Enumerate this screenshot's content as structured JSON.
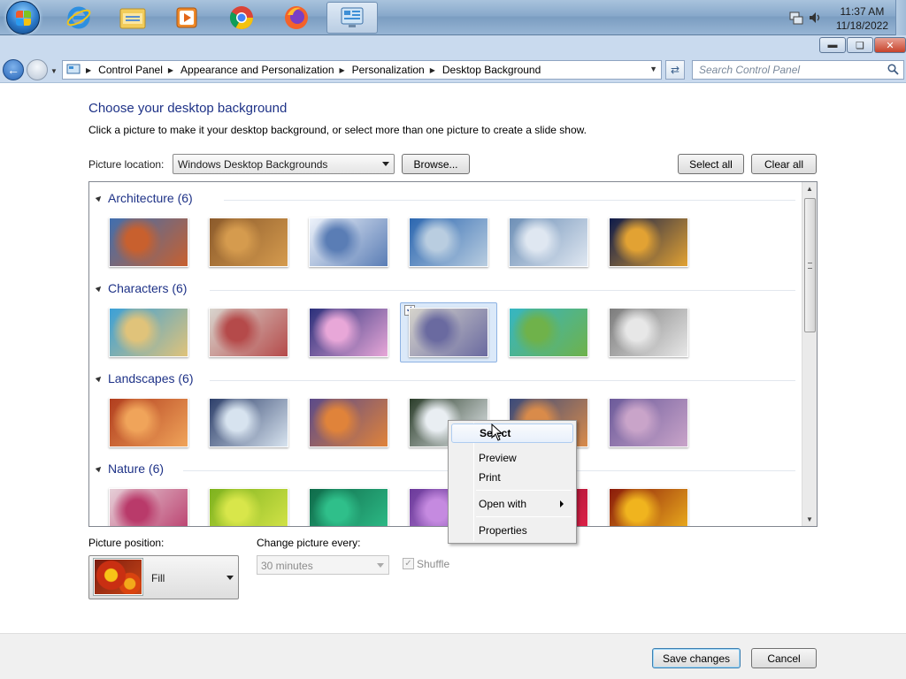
{
  "taskbar": {
    "apps": [
      {
        "name": "internet-explorer-icon"
      },
      {
        "name": "windows-explorer-icon"
      },
      {
        "name": "media-player-icon"
      },
      {
        "name": "chrome-icon"
      },
      {
        "name": "firefox-icon"
      },
      {
        "name": "control-panel-icon",
        "active": true
      }
    ],
    "tray": {
      "time": "11:37 AM",
      "date": "11/18/2022"
    }
  },
  "navbar": {
    "breadcrumbs": [
      "Control Panel",
      "Appearance and Personalization",
      "Personalization",
      "Desktop Background"
    ],
    "search_placeholder": "Search Control Panel"
  },
  "page": {
    "title": "Choose your desktop background",
    "description": "Click a picture to make it your desktop background, or select more than one picture to create a slide show.",
    "location_label": "Picture location:",
    "location_value": "Windows Desktop Backgrounds",
    "browse_label": "Browse...",
    "select_all_label": "Select all",
    "clear_all_label": "Clear all"
  },
  "gallery": {
    "groups": [
      {
        "name": "Architecture (6)",
        "thumbs": [
          [
            "#3f6fb0",
            "#c8602e"
          ],
          [
            "#8b5a2b",
            "#d59b4e"
          ],
          [
            "#eef3fb",
            "#5a7db5"
          ],
          [
            "#2b66b0",
            "#b9cde0"
          ],
          [
            "#6d8fb6",
            "#dfe7f1"
          ],
          [
            "#0d1a4a",
            "#e2a233"
          ]
        ]
      },
      {
        "name": "Characters (6)",
        "thumbs": [
          [
            "#3aa0d8",
            "#e0c37a"
          ],
          [
            "#d9d6cf",
            "#b54a4a"
          ],
          [
            "#2a2f7a",
            "#e8a7d8"
          ],
          [
            "#d6d4cc",
            "#6a6aa0"
          ],
          [
            "#35b6c4",
            "#6fb24a"
          ],
          [
            "#7b7b7b",
            "#e7e7e7"
          ]
        ],
        "selected_index": 3
      },
      {
        "name": "Landscapes (6)",
        "thumbs": [
          [
            "#b13d1e",
            "#f0a45a"
          ],
          [
            "#2d3f6a",
            "#d7e3ef"
          ],
          [
            "#5a4a8a",
            "#e0833a"
          ],
          [
            "#2b3d2a",
            "#e9eef2"
          ],
          [
            "#3a4a7a",
            "#d98b4a"
          ],
          [
            "#6b5a9a",
            "#c9a4c9"
          ]
        ]
      },
      {
        "name": "Nature (6)",
        "thumbs": [
          [
            "#e6d0d8",
            "#b93a6a"
          ],
          [
            "#7db21e",
            "#d8e64a"
          ],
          [
            "#0f6b4a",
            "#2fbf8a"
          ],
          [
            "#6b3a9a",
            "#c58ae0"
          ],
          [
            "#8a0f2a",
            "#e3224a"
          ],
          [
            "#8a1a0a",
            "#f0b41e"
          ]
        ]
      }
    ]
  },
  "context_menu": {
    "items": [
      "Select",
      "Preview",
      "Print",
      "Open with",
      "Properties"
    ]
  },
  "settings": {
    "position_label": "Picture position:",
    "position_value": "Fill",
    "change_label": "Change picture every:",
    "change_value": "30 minutes",
    "shuffle_label": "Shuffle",
    "shuffle_checked": true
  },
  "footer": {
    "save_label": "Save changes",
    "cancel_label": "Cancel"
  }
}
